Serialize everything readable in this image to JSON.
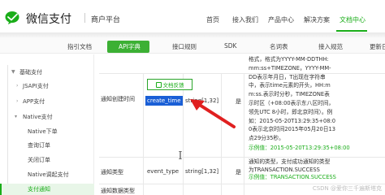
{
  "header": {
    "brand": "微信支付",
    "sub": "商户平台",
    "nav": [
      {
        "label": "首页"
      },
      {
        "label": "接入我们"
      },
      {
        "label": "产品中心"
      },
      {
        "label": "解决方案"
      },
      {
        "label": "文档中心"
      }
    ],
    "active_nav_color": "#1aad19"
  },
  "subtabs": [
    {
      "label": "指引文档"
    },
    {
      "label": "API字典"
    },
    {
      "label": "接口规则"
    },
    {
      "label": "SDK"
    },
    {
      "label": "名词表"
    },
    {
      "label": "接入规范"
    },
    {
      "label": "更新日"
    }
  ],
  "sidebar": {
    "items": [
      {
        "label": "基础支付"
      },
      {
        "label": "JSAPI支付"
      },
      {
        "label": "APP支付"
      },
      {
        "label": "Native支付"
      },
      {
        "label": "Native下单"
      },
      {
        "label": "查询订单"
      },
      {
        "label": "关闭订单"
      },
      {
        "label": "Native调起支付"
      },
      {
        "label": "支付通知"
      }
    ]
  },
  "content": {
    "doc_button": "文档反馈",
    "rows": [
      {
        "name": "通知创建时间",
        "field": "create_time",
        "type": "string[1,32]",
        "required": "是",
        "desc_lines": [
          "格式，格式为YYYY-MM-DDTHH:",
          "mm:ss+TIMEZONE，YYYY-MM-",
          "DD表示年月日，T出现在字符串",
          "中，表示time元素的开头，HH:m",
          "m:ss.表示时分秒，TIMEZONE表",
          "示时区（+08:00表示东八区时间，",
          "领先UTC 8小时，即北京时间）。例",
          "如：2015-05-20T13:29:35+08:0",
          "0表示北京时间2015年05月20日13",
          "点29分35秒。"
        ],
        "example": "示例值：2015-05-20T13:29:35+08:00"
      },
      {
        "name": "通知类型",
        "field": "event_type",
        "type": "string[1,32]",
        "required": "是",
        "desc_lines": [
          "通知的类型，支付成功通知的类型",
          "为TRANSACTION.SUCCESS"
        ],
        "example": "示例值：TRANSACTION.SUCCESS"
      }
    ],
    "bottom_line": "通知数据类型"
  },
  "watermark": "CSDN @爱你三千遍斯塔克",
  "colors": {
    "brand_green": "#1aad19",
    "selection_blue": "#1a5fd6",
    "arrow_red": "#e02020"
  }
}
